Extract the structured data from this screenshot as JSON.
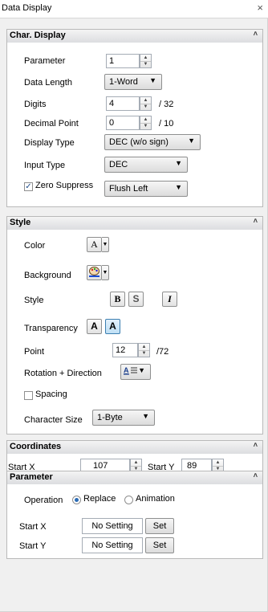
{
  "window": {
    "title": "Data Display",
    "close_label": "×"
  },
  "char_display": {
    "header": "Char. Display",
    "parameter": {
      "label": "Parameter",
      "value": "1"
    },
    "data_length": {
      "label": "Data Length",
      "value": "1-Word"
    },
    "digits": {
      "label": "Digits",
      "value": "4",
      "max": "/ 32"
    },
    "decimal_point": {
      "label": "Decimal Point",
      "value": "0",
      "max": "/ 10"
    },
    "display_type": {
      "label": "Display Type",
      "value": "DEC (w/o sign)"
    },
    "input_type": {
      "label": "Input Type",
      "value": "DEC"
    },
    "zero_suppress": {
      "label": "Zero Suppress",
      "checked": true,
      "value": "Flush Left"
    }
  },
  "style": {
    "header": "Style",
    "color_label": "Color",
    "color_glyph": "A",
    "background_label": "Background",
    "style_label": "Style",
    "bold_glyph": "B",
    "shadow_glyph": "S",
    "italic_glyph": "I",
    "transparency_label": "Transparency",
    "transparency_opt1": "A",
    "transparency_opt2": "A",
    "point": {
      "label": "Point",
      "value": "12",
      "max": "/72"
    },
    "rotation_label": "Rotation + Direction",
    "spacing_label": "Spacing",
    "spacing_checked": false,
    "char_size": {
      "label": "Character Size",
      "value": "1-Byte"
    }
  },
  "coordinates": {
    "header": "Coordinates",
    "start_x": {
      "label": "Start X",
      "value": "107"
    },
    "start_y": {
      "label": "Start Y",
      "value": "89"
    }
  },
  "parameter": {
    "header": "Parameter",
    "operation_label": "Operation",
    "options": [
      "Replace",
      "Animation"
    ],
    "selected": "Replace",
    "start_x": {
      "label": "Start X",
      "value": "No Setting",
      "button": "Set"
    },
    "start_y": {
      "label": "Start Y",
      "value": "No Setting",
      "button": "Set"
    }
  },
  "colors": {
    "section_border": "#b9b9b9",
    "accent_blue": "#2a6bb5",
    "active_button": "#bfe0f5"
  },
  "icons": {
    "collapse": "chevron-up-icon",
    "spin": "spin-up-down-icon",
    "dropdown": "chevron-down-icon",
    "background": "paint-palette-icon",
    "rotation": "text-direction-icon"
  }
}
